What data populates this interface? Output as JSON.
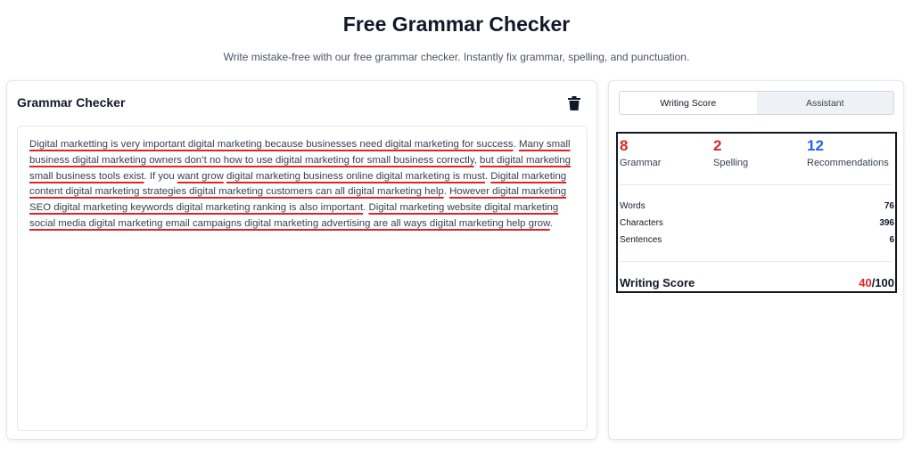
{
  "header": {
    "title": "Free Grammar Checker",
    "subtitle": "Write mistake-free with our free grammar checker. Instantly fix grammar, spelling, and punctuation."
  },
  "editor": {
    "title": "Grammar Checker",
    "delete_icon": "trash-icon",
    "segments": [
      {
        "text": "Digital marketting",
        "error": true
      },
      {
        "text": " is very important digital marketing because businesses need digital marketing for success",
        "error": true
      },
      {
        "text": ". ",
        "error": false
      },
      {
        "text": "Many small business digital marketing owners don’t no how to use digital marketing for small business correctly",
        "error": true
      },
      {
        "text": ", ",
        "error": false
      },
      {
        "text": "but digital marketing small business tools exist",
        "error": true
      },
      {
        "text": ". If you ",
        "error": false
      },
      {
        "text": "want grow",
        "error": true
      },
      {
        "text": " ",
        "error": false
      },
      {
        "text": "digital marketing business online digital marketing is must",
        "error": true
      },
      {
        "text": ". ",
        "error": false
      },
      {
        "text": "Digital marketing content digital marketing strategies digital marketing customers can all digital marketing help",
        "error": true
      },
      {
        "text": ". ",
        "error": false
      },
      {
        "text": "However digital marketing SEO digital marketing keywords digital marketing ranking is also important",
        "error": true
      },
      {
        "text": ". ",
        "error": false
      },
      {
        "text": "Digital marketing website digital marketing social media digital marketing email campaigns digital marketing advertising are all ways digital marketing help grow",
        "error": true
      },
      {
        "text": ".",
        "error": false
      }
    ]
  },
  "sidebar": {
    "tabs": [
      {
        "label": "Writing Score",
        "active": true
      },
      {
        "label": "Assistant",
        "active": false
      }
    ],
    "counts": {
      "grammar": {
        "value": "8",
        "label": "Grammar",
        "color": "#dc2626"
      },
      "spelling": {
        "value": "2",
        "label": "Spelling",
        "color": "#dc2626"
      },
      "recommendations": {
        "value": "12",
        "label": "Recommendations",
        "color": "#2563eb"
      }
    },
    "stats": {
      "words": {
        "label": "Words",
        "value": "76"
      },
      "characters": {
        "label": "Characters",
        "value": "396"
      },
      "sentences": {
        "label": "Sentences",
        "value": "6"
      }
    },
    "writing_score": {
      "label": "Writing Score",
      "score": "40",
      "max": "/100"
    }
  },
  "colors": {
    "error_underline": "#dc2626",
    "accent_blue": "#2563eb"
  }
}
